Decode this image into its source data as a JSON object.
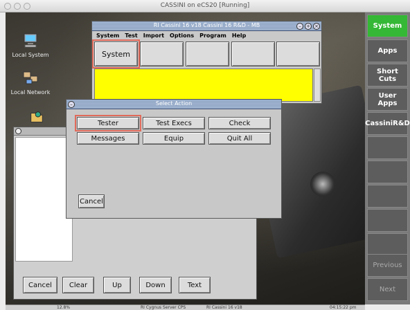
{
  "window": {
    "title": "CASSINI on eCS20 [Running]"
  },
  "desktop_icons": [
    {
      "label": "Local System"
    },
    {
      "label": "Local Network"
    }
  ],
  "sidebar": {
    "items": [
      {
        "label": "System",
        "active": true
      },
      {
        "label": "Apps"
      },
      {
        "label": "Short Cuts"
      },
      {
        "label": "User Apps"
      },
      {
        "label": "CassiniR&D"
      },
      {
        "label": ""
      },
      {
        "label": ""
      },
      {
        "label": ""
      },
      {
        "label": ""
      },
      {
        "label": ""
      },
      {
        "label": "Previous"
      },
      {
        "label": "Next"
      }
    ]
  },
  "main_app": {
    "title": "RI Cassini 16 v18  Cassini 16 R&D - MB",
    "menu": [
      "System",
      "Test",
      "Import",
      "Options",
      "Program",
      "Help"
    ],
    "tab_system": "System"
  },
  "select_action": {
    "title": "Select Action",
    "buttons": [
      "Tester",
      "Test Execs",
      "Check",
      "Messages",
      "Equip",
      "Quit All"
    ],
    "cancel": "Cancel"
  },
  "bottom_bar": {
    "buttons": [
      "Cancel",
      "Clear",
      "Up",
      "Down",
      "Text"
    ]
  },
  "taskbar": {
    "percent": "12.8%",
    "items": [
      "RI Cygnus Server CPS",
      "RI Cassini 16 v18"
    ],
    "clock": "04:15:22 pm"
  },
  "colors": {
    "active_green": "#35b835",
    "yellow_panel": "#ffff00",
    "highlight": "#e06a5a"
  }
}
